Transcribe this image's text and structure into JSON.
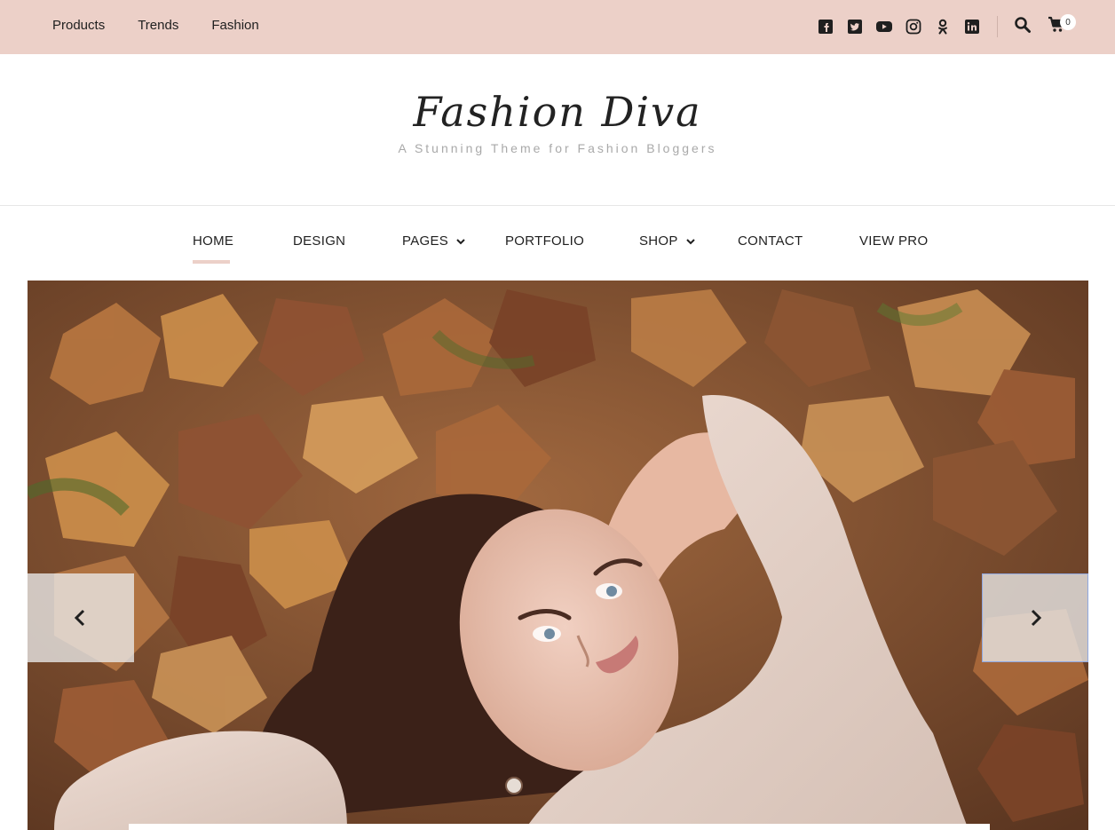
{
  "topbar": {
    "links": [
      "Products",
      "Trends",
      "Fashion"
    ],
    "social_icons": [
      "facebook-icon",
      "twitter-icon",
      "youtube-icon",
      "instagram-icon",
      "odnoklassniki-icon",
      "linkedin-icon"
    ],
    "cart_count": "0",
    "background": "#ecd0c8"
  },
  "header": {
    "site_title": "Fashion Diva",
    "tagline": "A Stunning Theme for Fashion Bloggers"
  },
  "nav": {
    "items": [
      {
        "label": "HOME",
        "active": true
      },
      {
        "label": "DESIGN"
      },
      {
        "label": "PAGES",
        "has_dropdown": true
      },
      {
        "label": "PORTFOLIO"
      },
      {
        "label": "SHOP",
        "has_dropdown": true
      },
      {
        "label": "CONTACT"
      },
      {
        "label": "VIEW PRO"
      }
    ]
  },
  "slider": {
    "image": "woman lying on autumn leaves in knit sweater",
    "prev_icon": "chevron-left-icon",
    "next_icon": "chevron-right-icon"
  }
}
